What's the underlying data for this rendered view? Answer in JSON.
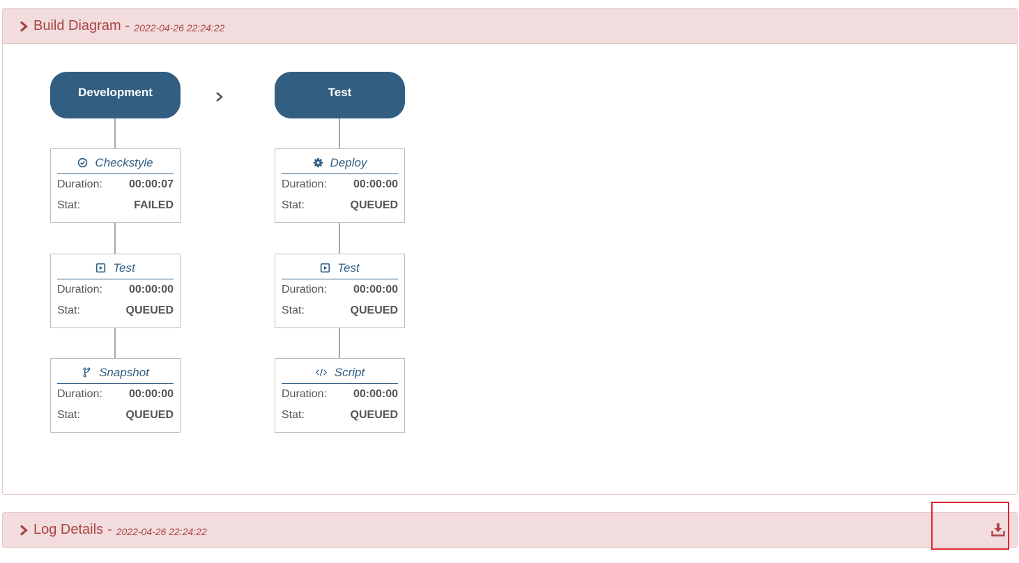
{
  "build_panel": {
    "title": "Build Diagram",
    "dash": "-",
    "timestamp": "2022-04-26 22:24:22"
  },
  "log_panel": {
    "title": "Log Details",
    "dash": "-",
    "timestamp": "2022-04-26 22:24:22"
  },
  "labels": {
    "duration": "Duration:",
    "stat": "Stat:"
  },
  "stages": [
    {
      "name": "Development",
      "steps": [
        {
          "name": "Checkstyle",
          "icon": "check-circle-icon",
          "duration": "00:00:07",
          "status": "FAILED",
          "status_color": "#ef4136"
        },
        {
          "name": "Test",
          "icon": "play-square-icon",
          "duration": "00:00:00",
          "status": "QUEUED",
          "status_color": "#9ea2a4"
        },
        {
          "name": "Snapshot",
          "icon": "code-fork-icon",
          "duration": "00:00:00",
          "status": "QUEUED",
          "status_color": "#9ea2a4"
        }
      ]
    },
    {
      "name": "Test",
      "steps": [
        {
          "name": "Deploy",
          "icon": "gear-icon",
          "duration": "00:00:00",
          "status": "QUEUED",
          "status_color": "#9ea2a4"
        },
        {
          "name": "Test",
          "icon": "play-square-icon",
          "duration": "00:00:00",
          "status": "QUEUED",
          "status_color": "#9ea2a4"
        },
        {
          "name": "Script",
          "icon": "code-icon",
          "duration": "00:00:00",
          "status": "QUEUED",
          "status_color": "#9ea2a4"
        }
      ]
    }
  ],
  "colors": {
    "stage": "#325e82",
    "panel_heading_bg": "#f2dcdd",
    "panel_heading_text": "#a94442",
    "failed": "#ef4136",
    "queued": "#9ea2a4",
    "highlight": "#d9232e"
  }
}
